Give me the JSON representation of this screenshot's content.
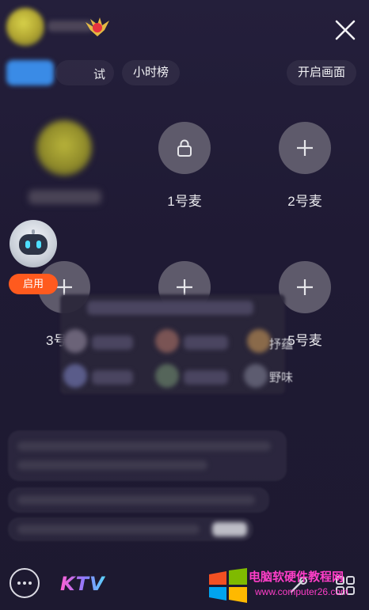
{
  "header": {
    "close_icon": "close-icon",
    "chips": [
      {
        "label": "试"
      },
      {
        "label": "小时榜"
      },
      {
        "label": "开启画面"
      }
    ]
  },
  "seats": [
    {
      "label": "1号麦"
    },
    {
      "label": "2号麦"
    },
    {
      "label": "3号"
    },
    {
      "label": "5号麦"
    }
  ],
  "robot": {
    "badge_label": "启用"
  },
  "overlay": {
    "texts": [
      "抒蕴",
      "野味"
    ]
  },
  "bottom_bar": {
    "ktv_label": "KTV",
    "more_icon": "more-dots-icon"
  },
  "watermark": {
    "title": "电脑软硬件教程网",
    "url": "www.computer26.com"
  },
  "colors": {
    "background": "#1f1b33",
    "seat": "#5e5a6b",
    "accent_orange": "#ff5a1e",
    "watermark_pink": "#ff3ec8"
  }
}
